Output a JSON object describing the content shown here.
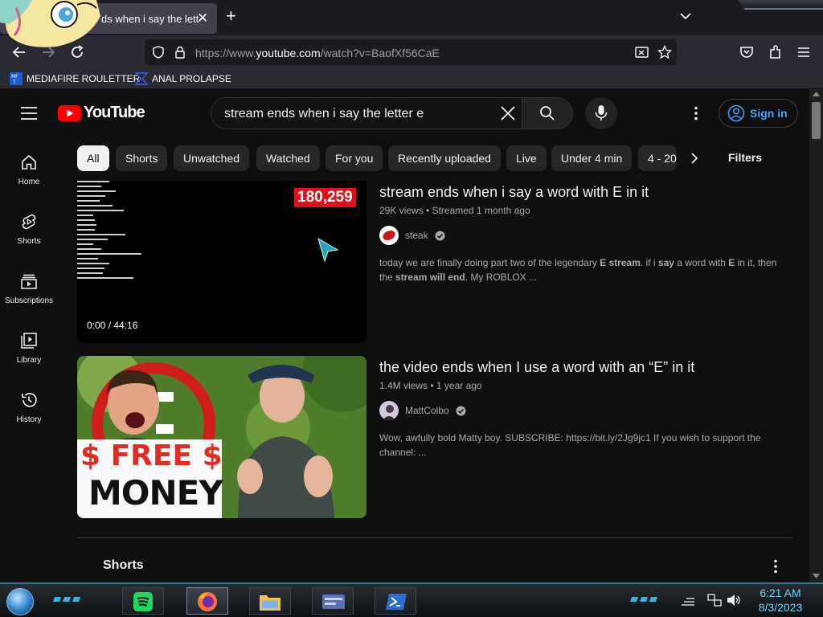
{
  "browser": {
    "tab_title": "ds when i say the lett",
    "url_prefix": "https://www.",
    "url_host": "youtube.com",
    "url_path": "/watch?v=BaofXf56CaE",
    "bookmarks": [
      {
        "label": "MEDIAFIRE ROULETTER",
        "icon": "mediafire-icon"
      },
      {
        "label": "ANAL PROLAPSE",
        "icon": "bookmark-chevron-icon"
      }
    ]
  },
  "youtube": {
    "logo_text": "YouTube",
    "search_query": "stream ends when i say the letter e",
    "sign_in_label": "Sign in",
    "guide": [
      {
        "label": "Home",
        "icon": "home-icon"
      },
      {
        "label": "Shorts",
        "icon": "shorts-icon"
      },
      {
        "label": "Subscriptions",
        "icon": "subscriptions-icon"
      },
      {
        "label": "Library",
        "icon": "library-icon"
      },
      {
        "label": "History",
        "icon": "history-icon"
      }
    ],
    "chips": [
      "All",
      "Shorts",
      "Unwatched",
      "Watched",
      "For you",
      "Recently uploaded",
      "Live",
      "Under 4 min",
      "4 - 20"
    ],
    "filters_label": "Filters",
    "videos": [
      {
        "title": "stream ends when i say a word with E in it",
        "meta": "29K views • Streamed 1 month ago",
        "channel": "steak",
        "description_parts": [
          "today we are finally doing part two of the legendary ",
          "E stream",
          ". if i ",
          "say",
          " a word with ",
          "E",
          " in it, then the ",
          "stream will end",
          ". My ROBLOX ..."
        ],
        "duration": "0:00 / 44:16",
        "overlay_counter": "180,259"
      },
      {
        "title": "the video ends when I use a word with an “E” in it",
        "meta": "1.4M views • 1 year ago",
        "channel": "MattColbo",
        "description": "Wow, awfully bold Matty boy. SUBSCRIBE: https://bit.ly/2Jg9jc1 If you wish to support the channel: ...",
        "thumb_text_1": "$ FREE $",
        "thumb_text_2": "MONEY"
      }
    ],
    "shorts_heading": "Shorts"
  },
  "taskbar": {
    "time": "6:21 AM",
    "date": "8/3/2023",
    "apps": [
      "spotify-icon",
      "firefox-icon",
      "file-explorer-icon",
      "control-panel-icon",
      "powershell-icon"
    ]
  },
  "colors": {
    "yt_red": "#ff0000",
    "link_blue": "#3ea6ff",
    "clock_cyan": "#67d7ff"
  }
}
